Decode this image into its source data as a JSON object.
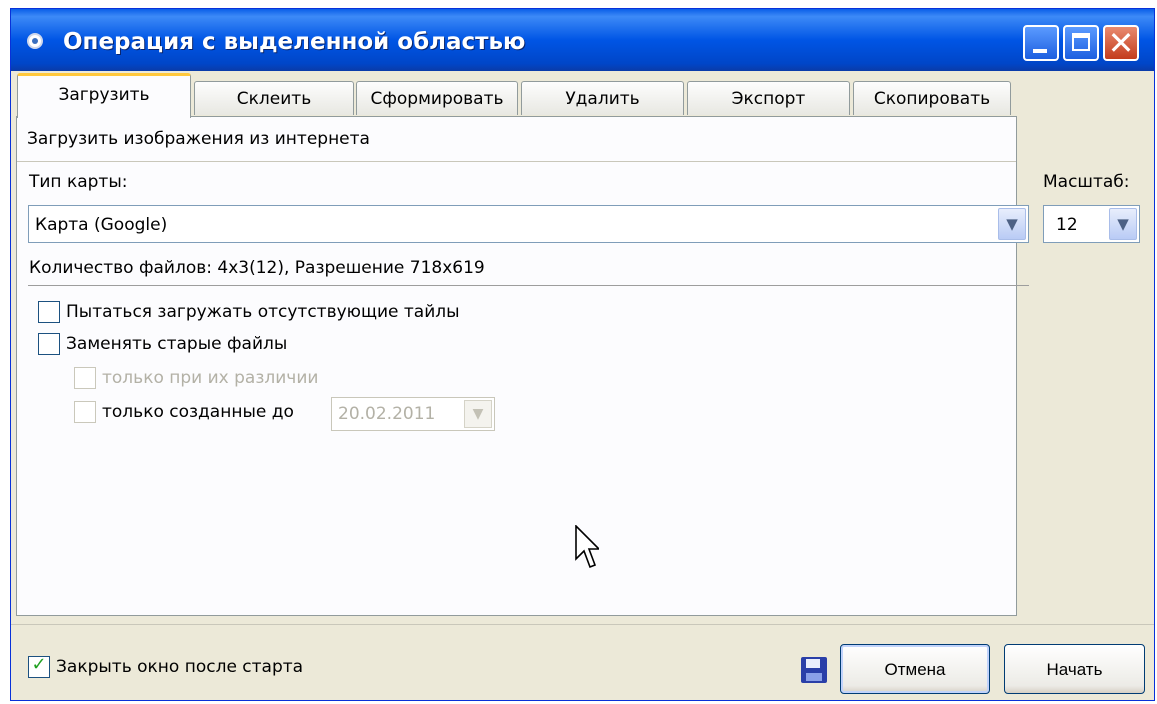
{
  "window": {
    "title": "Операция с выделенной областью",
    "controls": {
      "minimize": "minimize",
      "maximize": "maximize",
      "close": "✕"
    }
  },
  "tabs": [
    "Загрузить",
    "Склеить",
    "Сформировать",
    "Удалить",
    "Экспорт",
    "Скопировать"
  ],
  "active_tab": "Загрузить",
  "panel": {
    "header": "Загрузить изображения из интернета",
    "map_type": {
      "label": "Тип карты:",
      "value": "Карта (Google)"
    },
    "scale": {
      "label": "Масштаб:",
      "value": "12"
    },
    "file_info": "Количество файлов: 4x3(12), Разрешение 718x619",
    "options": {
      "retry_missing": {
        "label": "Пытаться загружать отсутствующие тайлы",
        "checked": false
      },
      "replace_old": {
        "label": "Заменять старые файлы",
        "checked": false
      },
      "only_if_different": {
        "label": "только при их различии",
        "checked": false,
        "enabled": false
      },
      "only_created_before": {
        "label": "только созданные до",
        "checked": false,
        "date": "20.02.2011",
        "date_enabled": false
      }
    }
  },
  "footer": {
    "close_after_start": {
      "label": "Закрыть окно после старта",
      "checked": true
    },
    "cancel": "Отмена",
    "start": "Начать"
  },
  "icons": {
    "title": "globe-icon",
    "save": "floppy-disk-icon",
    "dropdown": "chevron-down-icon",
    "pointer": "mouse-cursor-icon"
  },
  "colors": {
    "titlebar": "#0055e5",
    "window_bg": "#ece9d8",
    "active_tab_accent": "#ffc83c",
    "close_button": "#c33c1d",
    "checkmark": "#21a121"
  }
}
